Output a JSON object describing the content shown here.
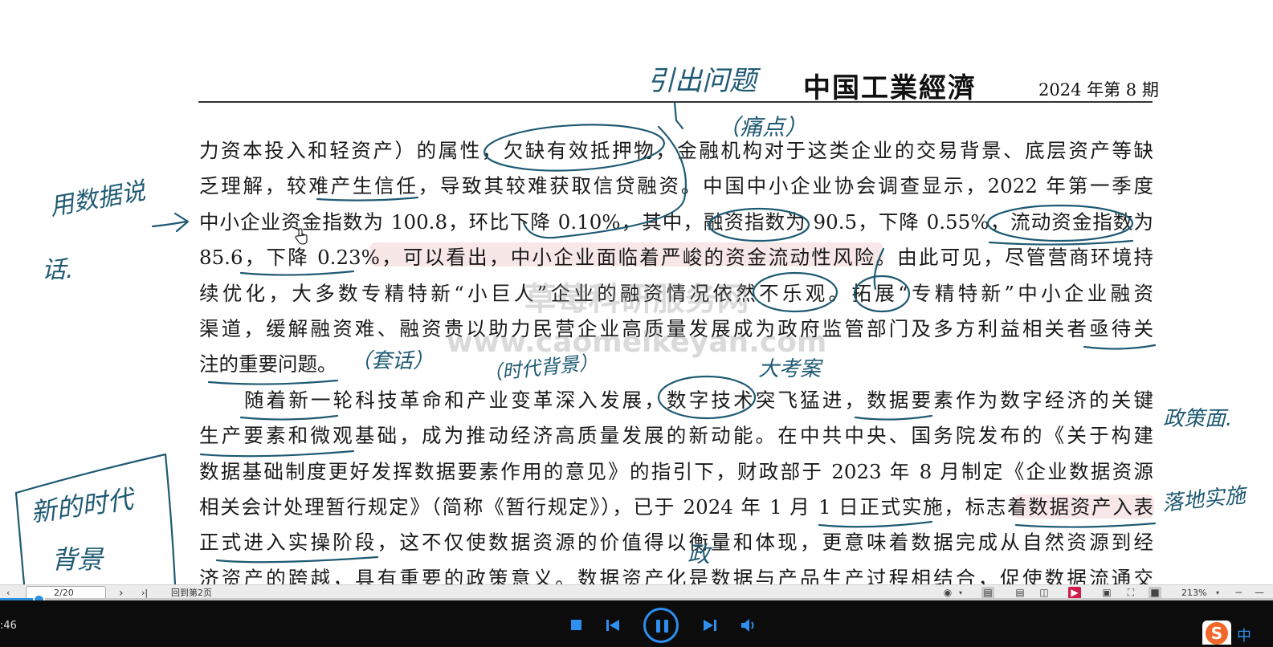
{
  "document": {
    "journal_name": "中国工業經濟",
    "issue": "2024 年第 8 期",
    "lines": [
      "力资本投入和轻资产）的属性，欠缺有效抵押物，金融机构对于这类企业的交易背景、底层资产等缺",
      "乏理解，较难产生信任，导致其较难获取信贷融资。中国中小企业协会调查显示，2022 年第一季度",
      "中小企业资金指数为 100.8，环比下降 0.10%，其中，融资指数为 90.5，下降 0.55%，流动资金指数为",
      "85.6，下降 0.23%，可以看出，中小企业面临着严峻的资金流动性风险。由此可见，尽管营商环境持",
      "续优化，大多数专精特新“小巨人”企业的融资情况依然不乐观。拓展“专精特新”中小企业融资",
      "渠道，缓解融资难、融资贵以助力民营企业高质量发展成为政府监管部门及多方利益相关者亟待关",
      "注的重要问题。",
      "随着新一轮科技革命和产业变革深入发展，数字技术突飞猛进，数据要素作为数字经济的关键",
      "生产要素和微观基础，成为推动经济高质量发展的新动能。在中共中央、国务院发布的《关于构建",
      "数据基础制度更好发挥数据要素作用的意见》的指引下，财政部于 2023 年 8 月制定《企业数据资源",
      "相关会计处理暂行规定》（简称《暂行规定》），已于 2024 年 1 月 1 日正式实施，标志着数据资产入表",
      "正式进入实操阶段，这不仅使数据资源的价值得以衡量和体现，更意味着数据完成从自然资源到经",
      "济资产的跨越，具有重要的政策意义。数据资产化是数据与产品生产过程相结合，促使数据流通交"
    ],
    "watermark": {
      "cn": "草莓科研服务网",
      "url": "www.caomeikeyan.com"
    }
  },
  "annotations": {
    "top_note": "引出问题",
    "paren_note_1": "（痛点）",
    "left_note_1a": "用数据说",
    "left_note_1b": "话.",
    "end_note_1": "（套话）",
    "era_note": "（时代背景）",
    "star_note": "大考案",
    "right_note_1": "政策面.",
    "right_note_2": "落地实施",
    "box_note_a": "新的时代",
    "box_note_b": "背景",
    "bottom_note": "政"
  },
  "viewer_toolbar": {
    "page_indicator": "2/20",
    "back_to_page": "回到第2页",
    "zoom": "213%"
  },
  "player": {
    "time": ":46",
    "progress_fraction": 0.031
  },
  "ime": {
    "logo": "S",
    "mode": "中"
  }
}
